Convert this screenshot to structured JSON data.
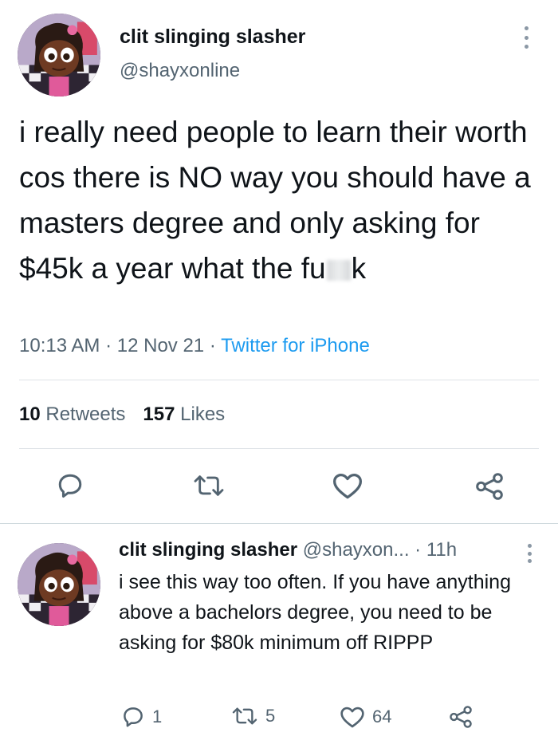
{
  "main_tweet": {
    "display_name": "clit slinging slasher",
    "handle": "@shayxonline",
    "text_before_censor": "i really need people to learn their worth cos there is NO way you should have a masters degree and only asking for $45k a year what the fu",
    "text_after_censor": "k",
    "time": "10:13 AM",
    "date": "12 Nov 21",
    "separator": "·",
    "source": "Twitter for iPhone",
    "retweets_count": "10",
    "retweets_label": "Retweets",
    "likes_count": "157",
    "likes_label": "Likes"
  },
  "reply_tweet": {
    "display_name": "clit slinging slasher",
    "handle_truncated": "@shayxon...",
    "separator": "·",
    "age": "11h",
    "text": "i see this way too often. If you have anything above a bachelors degree, you need to be asking for $80k minimum off RIPPP",
    "reply_count": "1",
    "retweet_count": "5",
    "like_count": "64"
  },
  "icons": {
    "reply": "comment-bubble-icon",
    "retweet": "retweet-icon",
    "like": "heart-icon",
    "share": "share-icon",
    "more": "more-dots-icon"
  },
  "colors": {
    "text": "#0f1419",
    "secondary": "#536471",
    "link": "#1d9bf0",
    "divider": "#dfe3e7"
  }
}
